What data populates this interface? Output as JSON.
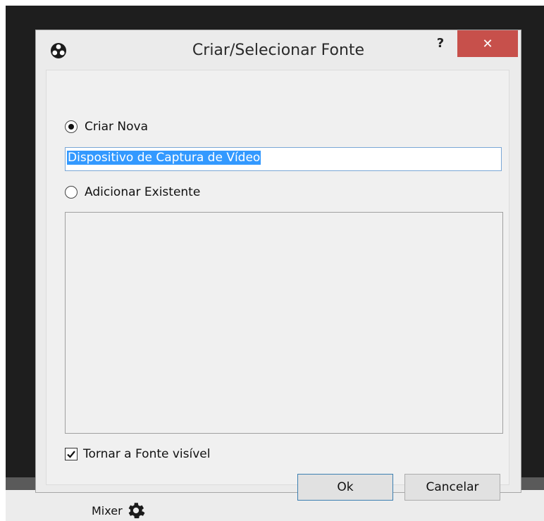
{
  "dialog": {
    "title": "Criar/Selecionar Fonte",
    "help_label": "?",
    "close_label": "✕"
  },
  "create_new": {
    "label": "Criar Nova",
    "selected": true,
    "input_value": "Dispositivo de Captura de Vídeo"
  },
  "add_existing": {
    "label": "Adicionar Existente",
    "selected": false,
    "items": []
  },
  "visible_checkbox": {
    "label": "Tornar a Fonte visível",
    "checked": true
  },
  "buttons": {
    "ok": "Ok",
    "cancel": "Cancelar"
  },
  "background": {
    "mixer_label": "Mixer"
  },
  "colors": {
    "close_button": "#c7504b",
    "selection": "#3399ff"
  }
}
